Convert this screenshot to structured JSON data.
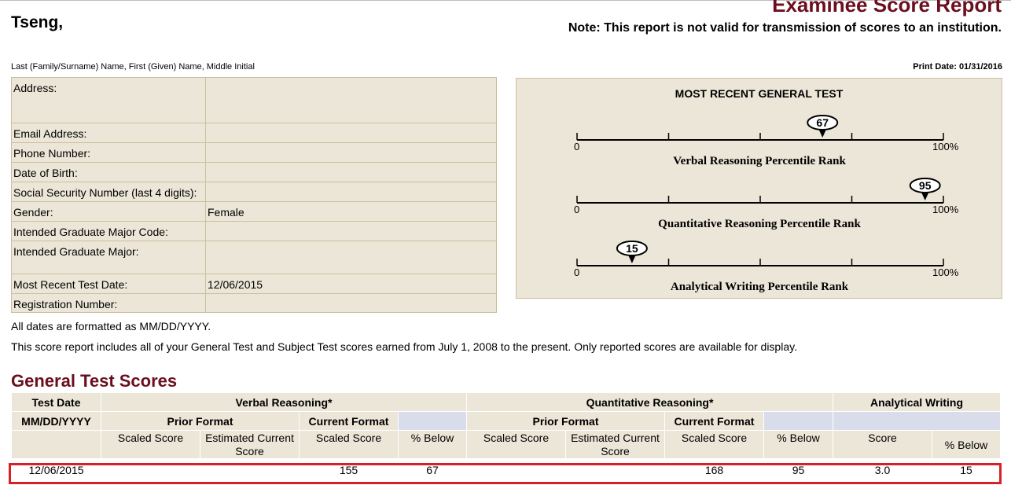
{
  "header": {
    "name": "Tseng,",
    "title": "Examinee Score Report",
    "note": "Note: This report is not valid for transmission of scores to an institution.",
    "name_caption": "Last (Family/Surname) Name, First (Given) Name, Middle Initial",
    "print_date": "Print Date: 01/31/2016"
  },
  "info": {
    "rows": [
      {
        "label": "Address:",
        "value": ""
      },
      {
        "label": "Email Address:",
        "value": ""
      },
      {
        "label": "Phone Number:",
        "value": ""
      },
      {
        "label": "Date of Birth:",
        "value": ""
      },
      {
        "label": "Social Security Number (last 4 digits):",
        "value": ""
      },
      {
        "label": "Gender:",
        "value": "Female"
      },
      {
        "label": "Intended Graduate Major Code:",
        "value": ""
      },
      {
        "label": "Intended Graduate Major:",
        "value": ""
      },
      {
        "label": "Most Recent Test Date:",
        "value": "12/06/2015"
      },
      {
        "label": "Registration Number:",
        "value": ""
      }
    ]
  },
  "percentile": {
    "title": "MOST RECENT GENERAL TEST",
    "min_label": "0",
    "max_label": "100%",
    "scales": [
      {
        "name": "Verbal Reasoning Percentile Rank",
        "value": 67
      },
      {
        "name": "Quantitative Reasoning Percentile Rank",
        "value": 95
      },
      {
        "name": "Analytical Writing Percentile Rank",
        "value": 15
      }
    ]
  },
  "notes": {
    "dates": "All dates are formatted as MM/DD/YYYY.",
    "scope": "This score report includes all of your General Test and Subject Test scores earned from July 1, 2008 to the present. Only reported scores are available for display."
  },
  "scores": {
    "section_title": "General Test Scores",
    "headers": {
      "test_date": "Test Date",
      "verbal": "Verbal Reasoning*",
      "quant": "Quantitative Reasoning*",
      "writing": "Analytical Writing",
      "date_format": "MM/DD/YYYY",
      "prior_format": "Prior Format",
      "current_format": "Current Format",
      "scaled_score": "Scaled Score",
      "estimated": "Estimated Current Score",
      "pct_below": "% Below",
      "score": "Score"
    },
    "row": {
      "date": "12/06/2015",
      "v_prior_scaled": "",
      "v_prior_est": "",
      "v_scaled": "155",
      "v_below": "67",
      "q_prior_scaled": "",
      "q_prior_est": "",
      "q_scaled": "168",
      "q_below": "95",
      "w_score": "3.0",
      "w_below": "15"
    }
  }
}
